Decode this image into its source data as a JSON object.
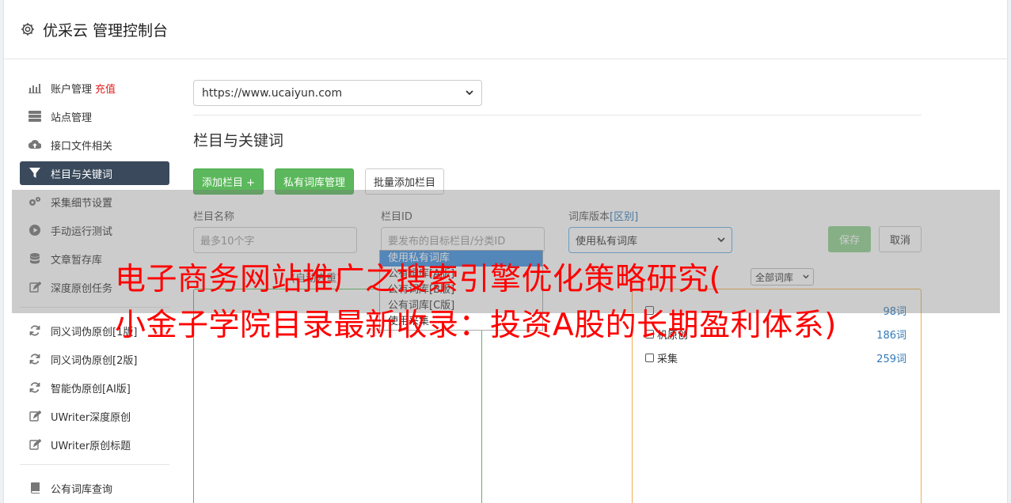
{
  "header": {
    "title": "优采云 管理控制台",
    "icon": "gear-icon"
  },
  "sidebar": {
    "items": [
      {
        "label": "账户管理",
        "extra": "充值",
        "icon": "bar-chart-icon"
      },
      {
        "label": "站点管理",
        "icon": "server-icon"
      },
      {
        "label": "接口文件相关",
        "icon": "cloud-upload-icon"
      },
      {
        "label": "栏目与关键词",
        "icon": "filter-icon",
        "active": true
      },
      {
        "label": "采集细节设置",
        "icon": "gears-icon"
      },
      {
        "label": "手动运行测试",
        "icon": "play-circle-icon"
      },
      {
        "label": "文章暂存库",
        "icon": "database-icon"
      },
      {
        "label": "深度原创任务",
        "icon": "edit-icon"
      },
      {
        "label": "同义词伪原创[1版]",
        "icon": "refresh-icon"
      },
      {
        "label": "同义词伪原创[2版]",
        "icon": "refresh-icon"
      },
      {
        "label": "智能伪原创[AI版]",
        "icon": "refresh-icon"
      },
      {
        "label": "UWriter深度原创",
        "icon": "edit-icon"
      },
      {
        "label": "UWriter原创标题",
        "icon": "edit-icon"
      },
      {
        "label": "公有词库查询",
        "icon": "book-icon"
      }
    ]
  },
  "main": {
    "site_select": "https://www.ucaiyun.com",
    "section_title": "栏目与关键词",
    "buttons": {
      "add_column": "添加栏目 +",
      "private_lib": "私有词库管理",
      "batch_add": "批量添加栏目"
    },
    "form": {
      "name_label": "栏目名称",
      "name_placeholder": "最多10个字",
      "id_label": "栏目ID",
      "id_placeholder": "要发布的目标栏目/分类ID",
      "version_label": "词库版本",
      "version_link": "[区别]",
      "version_value": "使用私有词库",
      "save": "保存",
      "cancel": "取消"
    },
    "dropdown_options": [
      "使用私有词库",
      "公有词库[A版]",
      "公有词库[B版]",
      "公有词库[C版]",
      "使用采集"
    ],
    "sub_label": "(自动去重)",
    "lib_select": "全部词库",
    "libraries": [
      {
        "name": "",
        "count": "98词"
      },
      {
        "name": "机原创",
        "count": "186词"
      },
      {
        "name": "采集",
        "count": "259词"
      }
    ]
  },
  "banner": {
    "line1": "电子商务网站推广之搜索引擎优化策略研究(",
    "line2": "小金子学院目录最新收录：投资A股的长期盈利体系)"
  }
}
